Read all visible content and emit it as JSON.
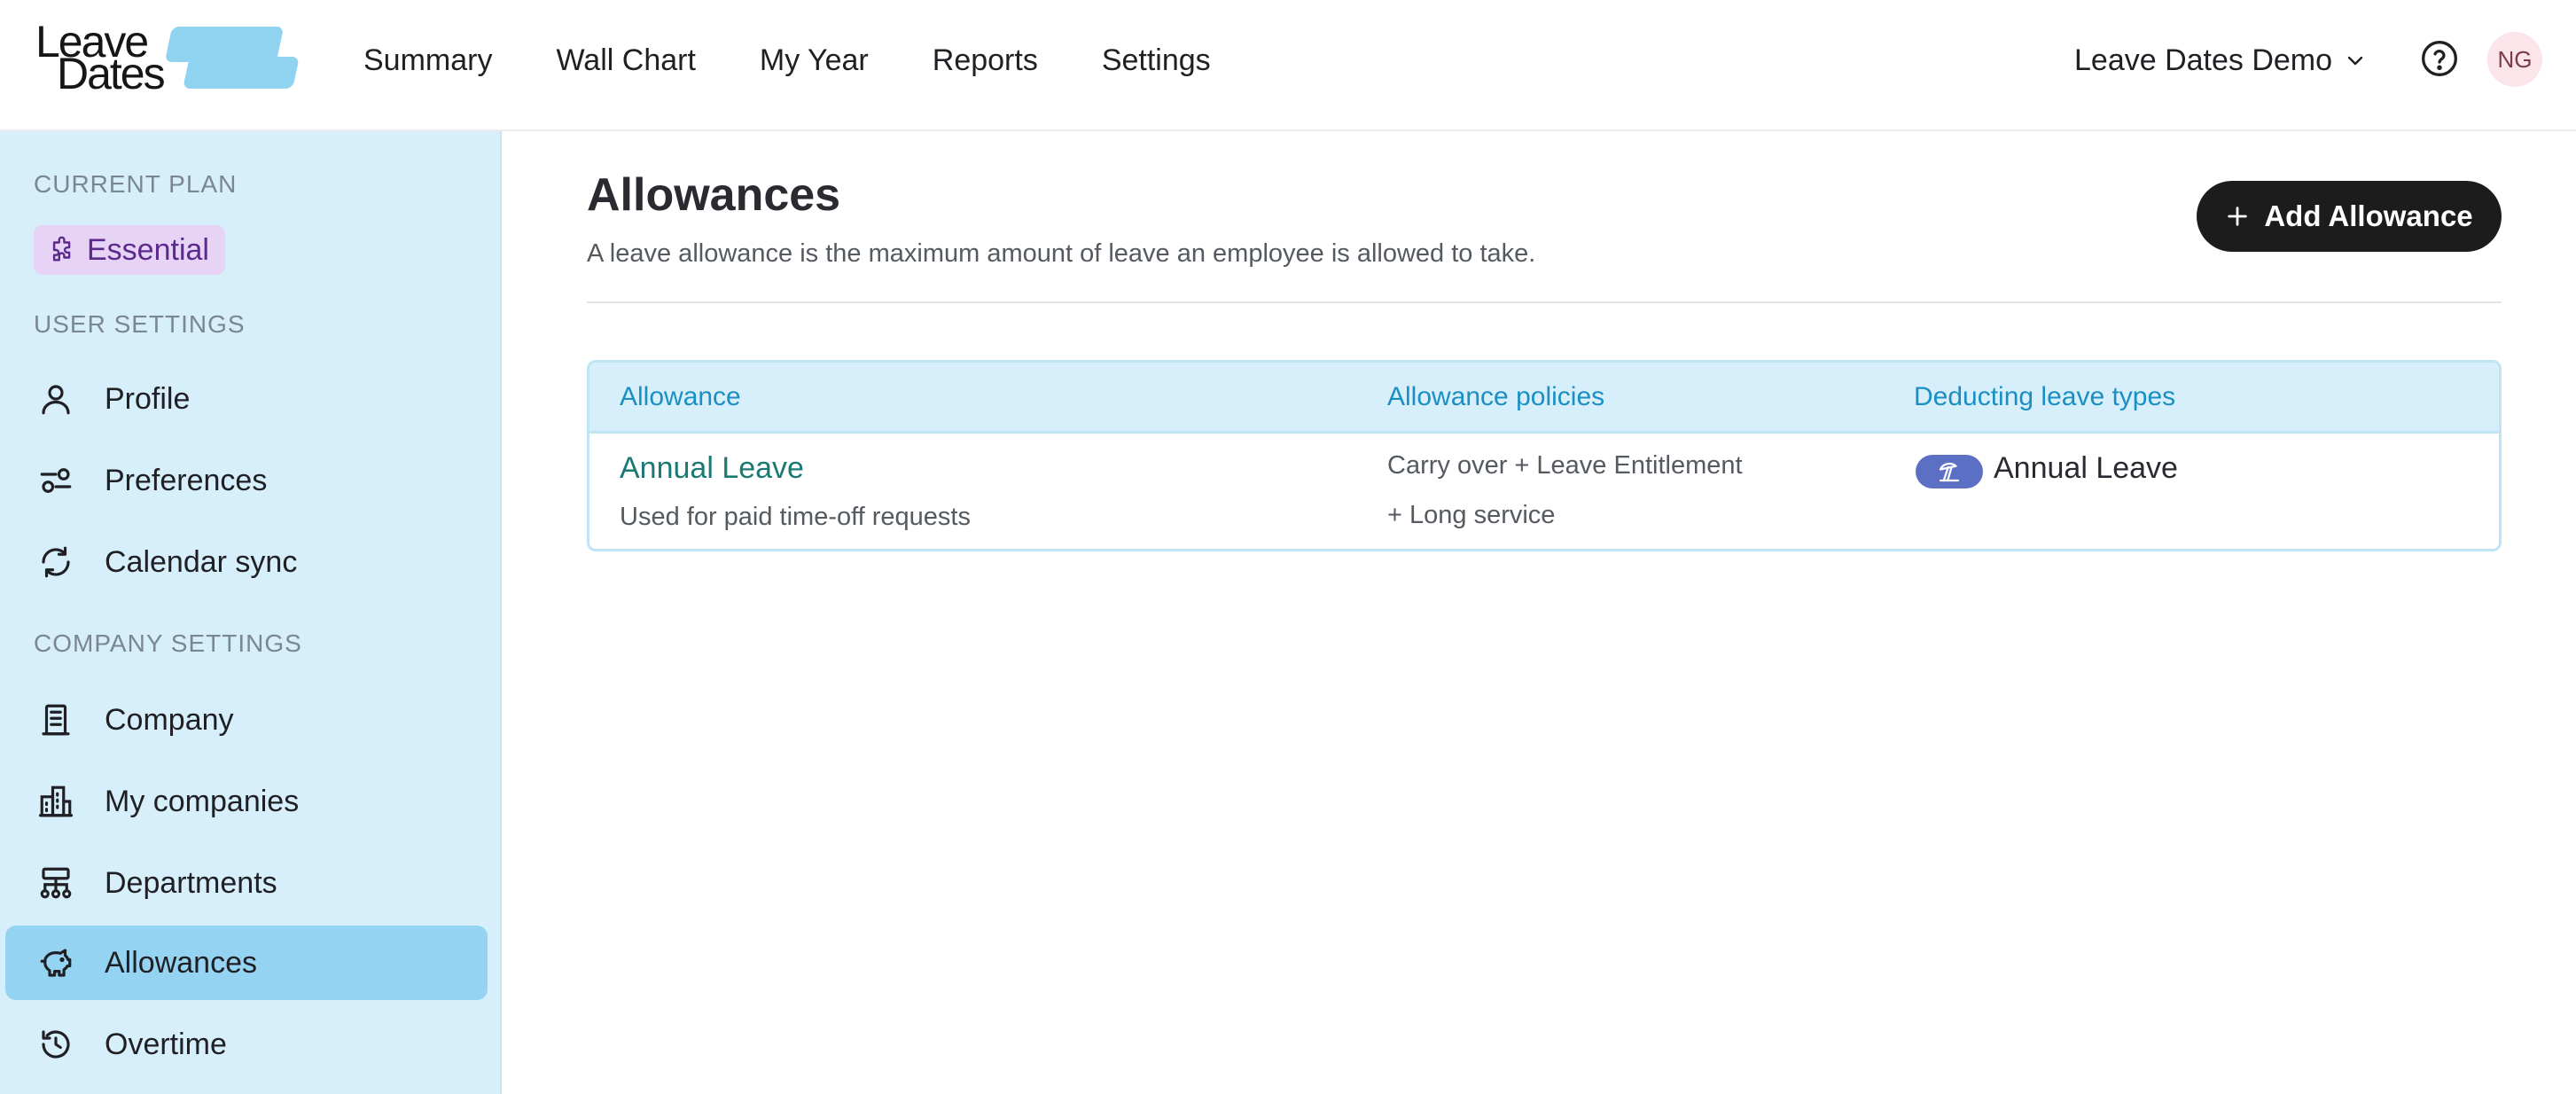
{
  "brand": {
    "line1": "Leave",
    "line2": "Dates"
  },
  "topnav": {
    "items": [
      {
        "label": "Summary"
      },
      {
        "label": "Wall Chart"
      },
      {
        "label": "My Year"
      },
      {
        "label": "Reports"
      },
      {
        "label": "Settings"
      }
    ]
  },
  "header": {
    "company_name": "Leave Dates Demo",
    "avatar_initials": "NG"
  },
  "sidebar": {
    "current_plan_label": "CURRENT PLAN",
    "plan_name": "Essential",
    "user_settings_label": "USER SETTINGS",
    "company_settings_label": "COMPANY SETTINGS",
    "items": [
      {
        "label": "Profile",
        "icon": "user-icon"
      },
      {
        "label": "Preferences",
        "icon": "sliders-icon"
      },
      {
        "label": "Calendar sync",
        "icon": "sync-icon"
      },
      {
        "label": "Company",
        "icon": "building-icon"
      },
      {
        "label": "My companies",
        "icon": "buildings-icon"
      },
      {
        "label": "Departments",
        "icon": "org-chart-icon"
      },
      {
        "label": "Allowances",
        "icon": "piggy-bank-icon",
        "active": true
      },
      {
        "label": "Overtime",
        "icon": "clock-rotate-icon"
      }
    ]
  },
  "main": {
    "title": "Allowances",
    "subtitle": "A leave allowance is the maximum amount of leave an employee is allowed to take.",
    "add_button_label": "Add Allowance",
    "table": {
      "columns": [
        "Allowance",
        "Allowance policies",
        "Deducting leave types"
      ],
      "rows": [
        {
          "name": "Annual Leave",
          "description": "Used for paid time-off requests",
          "policies_line1": "Carry over  + Leave Entitlement",
          "policies_line2": "+ Long service",
          "leave_type": "Annual Leave",
          "leave_type_icon": "beach-umbrella-icon"
        }
      ]
    }
  },
  "colors": {
    "sidebar_bg": "#d6effa",
    "sidebar_active": "#94d3f1",
    "accent_blue": "#1b8fc3",
    "allowance_link": "#1a7a73",
    "plan_badge": "#e6d3f5",
    "leave_chip": "#5b6fc4",
    "button_dark": "#1c1c1c"
  }
}
